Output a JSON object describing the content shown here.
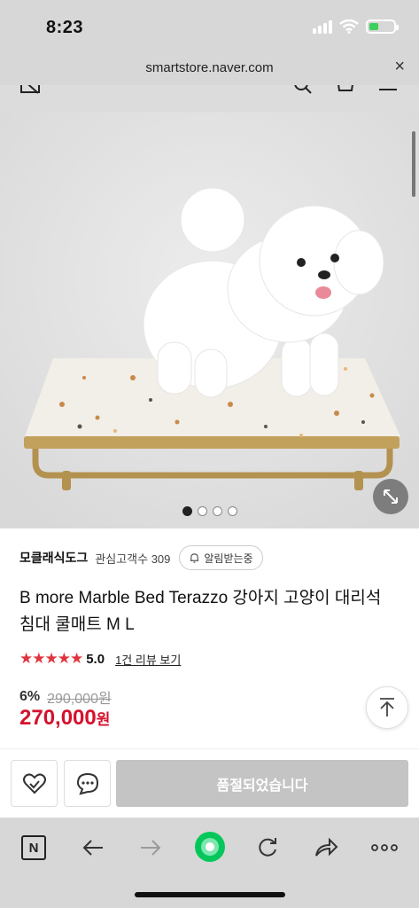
{
  "status_bar": {
    "time": "8:23",
    "battery_percent": 40
  },
  "address_bar": {
    "url": "smartstore.naver.com",
    "close_label": "×"
  },
  "product": {
    "image_count": 4,
    "active_image_index": 0,
    "store_name": "모클래식도그",
    "fans_label": "관심고객수 309",
    "alarm_label": "알림받는중",
    "title": "B more Marble Bed Terazzo 강아지 고양이 대리석 침대 쿨매트 M L",
    "stars": "★★★★★",
    "rating": "5.0",
    "review_link": "1건 리뷰 보기",
    "discount": "6%",
    "original_price": "290,000원",
    "price": "270,000",
    "price_unit": "원"
  },
  "action_bar": {
    "soldout_label": "품절되었습니다"
  },
  "browser_toolbar": {
    "naver_label": "N"
  },
  "colors": {
    "accent_red": "#d5112d",
    "star_red": "#e0343c",
    "naver_green": "#03c75a",
    "soldout_grey": "#c4c4c4"
  }
}
